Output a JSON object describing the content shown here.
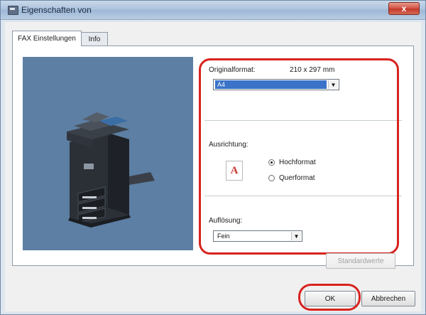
{
  "window": {
    "title": "Eigenschaften von",
    "close_label": "x"
  },
  "tabs": [
    {
      "label": "FAX Einstellungen",
      "active": true
    },
    {
      "label": "Info",
      "active": false
    }
  ],
  "fax_settings": {
    "original_format": {
      "label": "Originalformat:",
      "size_text": "210 x 297 mm",
      "selected": "A4"
    },
    "orientation": {
      "label": "Ausrichtung:",
      "icon_letter": "A",
      "options": [
        {
          "label": "Hochformat",
          "checked": true
        },
        {
          "label": "Querformat",
          "checked": false
        }
      ]
    },
    "resolution": {
      "label": "Auflösung:",
      "selected": "Fein"
    },
    "standard_button": "Standardwerte"
  },
  "buttons": {
    "ok": "OK",
    "cancel": "Abbrechen"
  },
  "colors": {
    "highlight_outline": "#d8231f",
    "selection": "#3a73c8",
    "preview_background": "#5c7fa3"
  }
}
